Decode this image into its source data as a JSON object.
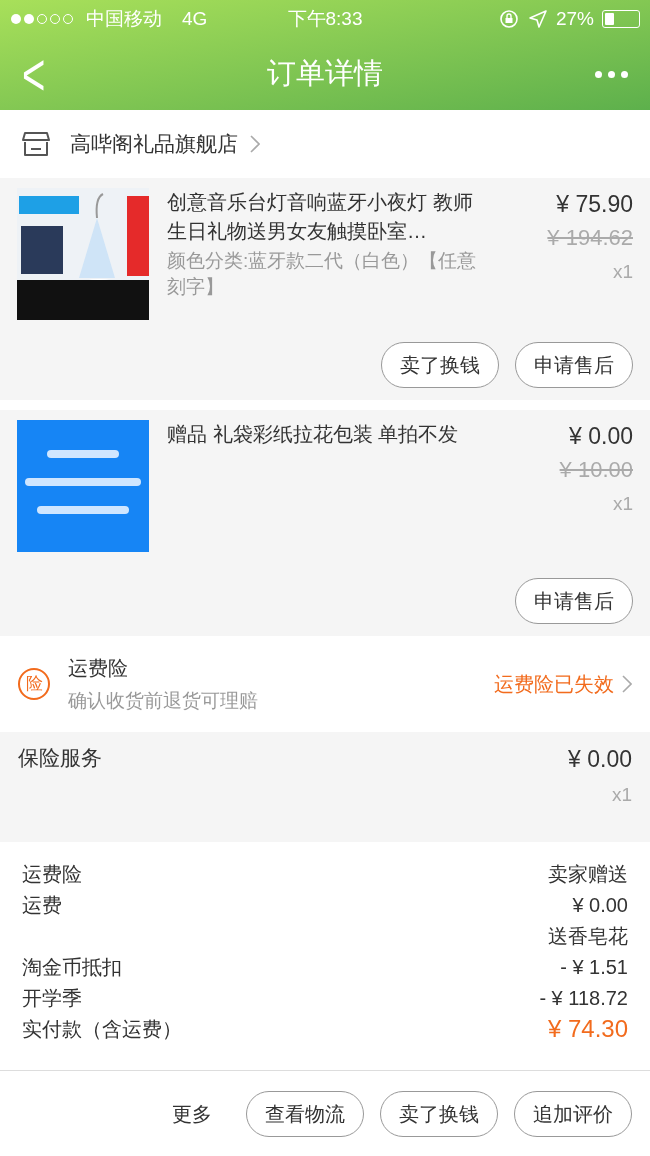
{
  "status_bar": {
    "carrier": "中国移动",
    "network": "4G",
    "time": "下午8:33",
    "battery": "27%"
  },
  "nav": {
    "title": "订单详情",
    "back": "<"
  },
  "store": {
    "name": "高哔阁礼品旗舰店"
  },
  "items": [
    {
      "title": "创意音乐台灯音响蓝牙小夜灯 教师生日礼物送男女友触摸卧室…",
      "sku": "颜色分类:蓝牙款二代（白色）【任意刻字】",
      "price": "¥ 75.90",
      "original_price": "¥ 194.62",
      "quantity": "x1",
      "buttons": [
        "卖了换钱",
        "申请售后"
      ]
    },
    {
      "title": "赠品 礼袋彩纸拉花包装 单拍不发",
      "price": "¥ 0.00",
      "original_price": "¥ 10.00",
      "quantity": "x1",
      "buttons": [
        "申请售后"
      ]
    }
  ],
  "shipping_insurance": {
    "badge": "险",
    "title": "运费险",
    "subtitle": "确认收货前退货可理赔",
    "status": "运费险已失效"
  },
  "insurance_service": {
    "title": "保险服务",
    "price": "¥ 0.00",
    "quantity": "x1"
  },
  "summary": [
    {
      "label": "运费险",
      "value": "卖家赠送",
      "kind": "normal"
    },
    {
      "label": "运费",
      "value": "¥ 0.00",
      "kind": "normal"
    },
    {
      "value": "送香皂花",
      "kind": "normal"
    },
    {
      "label": "淘金币抵扣",
      "value": "- ¥ 1.51",
      "kind": "normal"
    },
    {
      "label": "开学季",
      "value": "- ¥ 118.72",
      "kind": "normal"
    },
    {
      "label": "实付款（含运费）",
      "value": "¥ 74.30",
      "kind": "total"
    }
  ],
  "bottom_bar": {
    "more": "更多",
    "buttons": [
      "查看物流",
      "卖了换钱",
      "追加评价"
    ]
  }
}
